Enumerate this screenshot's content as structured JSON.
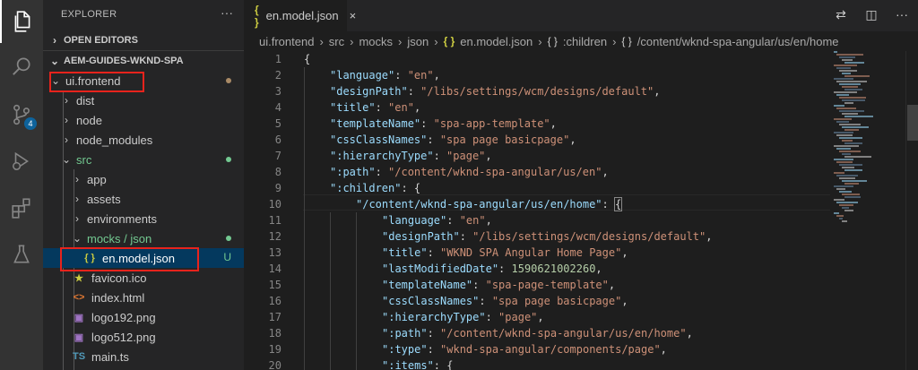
{
  "colors": {
    "activity_bg": "#333333",
    "sidebar_bg": "#252526",
    "editor_bg": "#1e1e1e",
    "key": "#9cdcfe",
    "string": "#ce9178",
    "number": "#b5cea8",
    "modified_dot": "#a98a66",
    "untracked": "#73c991",
    "highlight_box": "#e8231c"
  },
  "activity_bar": {
    "icons": [
      "files-icon",
      "search-icon",
      "source-control-icon",
      "run-debug-icon",
      "extensions-icon",
      "testing-icon"
    ],
    "scm_badge": "4"
  },
  "sidebar": {
    "title": "EXPLORER",
    "more_label": "···",
    "open_editors": "OPEN EDITORS",
    "workspace": "AEM-GUIDES-WKND-SPA",
    "tree": [
      {
        "label": "ui.frontend",
        "type": "folder",
        "open": true,
        "status": "modified"
      },
      {
        "label": "dist",
        "type": "folder",
        "open": false
      },
      {
        "label": "node",
        "type": "folder",
        "open": false
      },
      {
        "label": "node_modules",
        "type": "folder",
        "open": false
      },
      {
        "label": "src",
        "type": "folder",
        "open": true,
        "status": "untracked"
      },
      {
        "label": "app",
        "type": "folder",
        "open": false
      },
      {
        "label": "assets",
        "type": "folder",
        "open": false
      },
      {
        "label": "environments",
        "type": "folder",
        "open": false
      },
      {
        "label": "mocks / json",
        "type": "folder",
        "open": true,
        "status": "untracked"
      },
      {
        "label": "en.model.json",
        "type": "json",
        "status_letter": "U",
        "selected": true
      },
      {
        "label": "favicon.ico",
        "type": "ico"
      },
      {
        "label": "index.html",
        "type": "html"
      },
      {
        "label": "logo192.png",
        "type": "png"
      },
      {
        "label": "logo512.png",
        "type": "png"
      },
      {
        "label": "main.ts",
        "type": "ts"
      }
    ],
    "file_icons": {
      "json": "{ }",
      "ico": "★",
      "html": "<>",
      "png": "▣",
      "ts": "TS"
    }
  },
  "editor": {
    "tab_label": "en.model.json",
    "tab_icon": "{ }",
    "close_glyph": "×",
    "actions": [
      "⇄",
      "◫",
      "···"
    ],
    "breadcrumb": [
      "ui.frontend",
      "src",
      "mocks",
      "json",
      "en.model.json",
      ":children",
      "/content/wknd-spa-angular/us/en/home"
    ],
    "code_lines": [
      {
        "n": "1",
        "indent": 0,
        "parts": [
          [
            "p",
            "{"
          ]
        ]
      },
      {
        "n": "2",
        "indent": 1,
        "parts": [
          [
            "k",
            "\"language\""
          ],
          [
            "p",
            ": "
          ],
          [
            "s",
            "\"en\""
          ],
          [
            "p",
            ","
          ]
        ]
      },
      {
        "n": "3",
        "indent": 1,
        "parts": [
          [
            "k",
            "\"designPath\""
          ],
          [
            "p",
            ": "
          ],
          [
            "s",
            "\"/libs/settings/wcm/designs/default\""
          ],
          [
            "p",
            ","
          ]
        ]
      },
      {
        "n": "4",
        "indent": 1,
        "parts": [
          [
            "k",
            "\"title\""
          ],
          [
            "p",
            ": "
          ],
          [
            "s",
            "\"en\""
          ],
          [
            "p",
            ","
          ]
        ]
      },
      {
        "n": "5",
        "indent": 1,
        "parts": [
          [
            "k",
            "\"templateName\""
          ],
          [
            "p",
            ": "
          ],
          [
            "s",
            "\"spa-app-template\""
          ],
          [
            "p",
            ","
          ]
        ]
      },
      {
        "n": "6",
        "indent": 1,
        "parts": [
          [
            "k",
            "\"cssClassNames\""
          ],
          [
            "p",
            ": "
          ],
          [
            "s",
            "\"spa page basicpage\""
          ],
          [
            "p",
            ","
          ]
        ]
      },
      {
        "n": "7",
        "indent": 1,
        "parts": [
          [
            "k",
            "\":hierarchyType\""
          ],
          [
            "p",
            ": "
          ],
          [
            "s",
            "\"page\""
          ],
          [
            "p",
            ","
          ]
        ]
      },
      {
        "n": "8",
        "indent": 1,
        "parts": [
          [
            "k",
            "\":path\""
          ],
          [
            "p",
            ": "
          ],
          [
            "s",
            "\"/content/wknd-spa-angular/us/en\""
          ],
          [
            "p",
            ","
          ]
        ]
      },
      {
        "n": "9",
        "indent": 1,
        "parts": [
          [
            "k",
            "\":children\""
          ],
          [
            "p",
            ": {"
          ]
        ]
      },
      {
        "n": "10",
        "indent": 2,
        "parts": [
          [
            "k",
            "\"/content/wknd-spa-angular/us/en/home\""
          ],
          [
            "p",
            ": "
          ],
          [
            "b",
            "{"
          ]
        ]
      },
      {
        "n": "11",
        "indent": 3,
        "parts": [
          [
            "k",
            "\"language\""
          ],
          [
            "p",
            ": "
          ],
          [
            "s",
            "\"en\""
          ],
          [
            "p",
            ","
          ]
        ]
      },
      {
        "n": "12",
        "indent": 3,
        "parts": [
          [
            "k",
            "\"designPath\""
          ],
          [
            "p",
            ": "
          ],
          [
            "s",
            "\"/libs/settings/wcm/designs/default\""
          ],
          [
            "p",
            ","
          ]
        ]
      },
      {
        "n": "13",
        "indent": 3,
        "parts": [
          [
            "k",
            "\"title\""
          ],
          [
            "p",
            ": "
          ],
          [
            "s",
            "\"WKND SPA Angular Home Page\""
          ],
          [
            "p",
            ","
          ]
        ]
      },
      {
        "n": "14",
        "indent": 3,
        "parts": [
          [
            "k",
            "\"lastModifiedDate\""
          ],
          [
            "p",
            ": "
          ],
          [
            "n",
            "1590621002260"
          ],
          [
            "p",
            ","
          ]
        ]
      },
      {
        "n": "15",
        "indent": 3,
        "parts": [
          [
            "k",
            "\"templateName\""
          ],
          [
            "p",
            ": "
          ],
          [
            "s",
            "\"spa-page-template\""
          ],
          [
            "p",
            ","
          ]
        ]
      },
      {
        "n": "16",
        "indent": 3,
        "parts": [
          [
            "k",
            "\"cssClassNames\""
          ],
          [
            "p",
            ": "
          ],
          [
            "s",
            "\"spa page basicpage\""
          ],
          [
            "p",
            ","
          ]
        ]
      },
      {
        "n": "17",
        "indent": 3,
        "parts": [
          [
            "k",
            "\":hierarchyType\""
          ],
          [
            "p",
            ": "
          ],
          [
            "s",
            "\"page\""
          ],
          [
            "p",
            ","
          ]
        ]
      },
      {
        "n": "18",
        "indent": 3,
        "parts": [
          [
            "k",
            "\":path\""
          ],
          [
            "p",
            ": "
          ],
          [
            "s",
            "\"/content/wknd-spa-angular/us/en/home\""
          ],
          [
            "p",
            ","
          ]
        ]
      },
      {
        "n": "19",
        "indent": 3,
        "parts": [
          [
            "k",
            "\":type\""
          ],
          [
            "p",
            ": "
          ],
          [
            "s",
            "\"wknd-spa-angular/components/page\""
          ],
          [
            "p",
            ","
          ]
        ]
      },
      {
        "n": "20",
        "indent": 3,
        "parts": [
          [
            "k",
            "\":items\""
          ],
          [
            "p",
            ": {"
          ]
        ]
      }
    ]
  }
}
